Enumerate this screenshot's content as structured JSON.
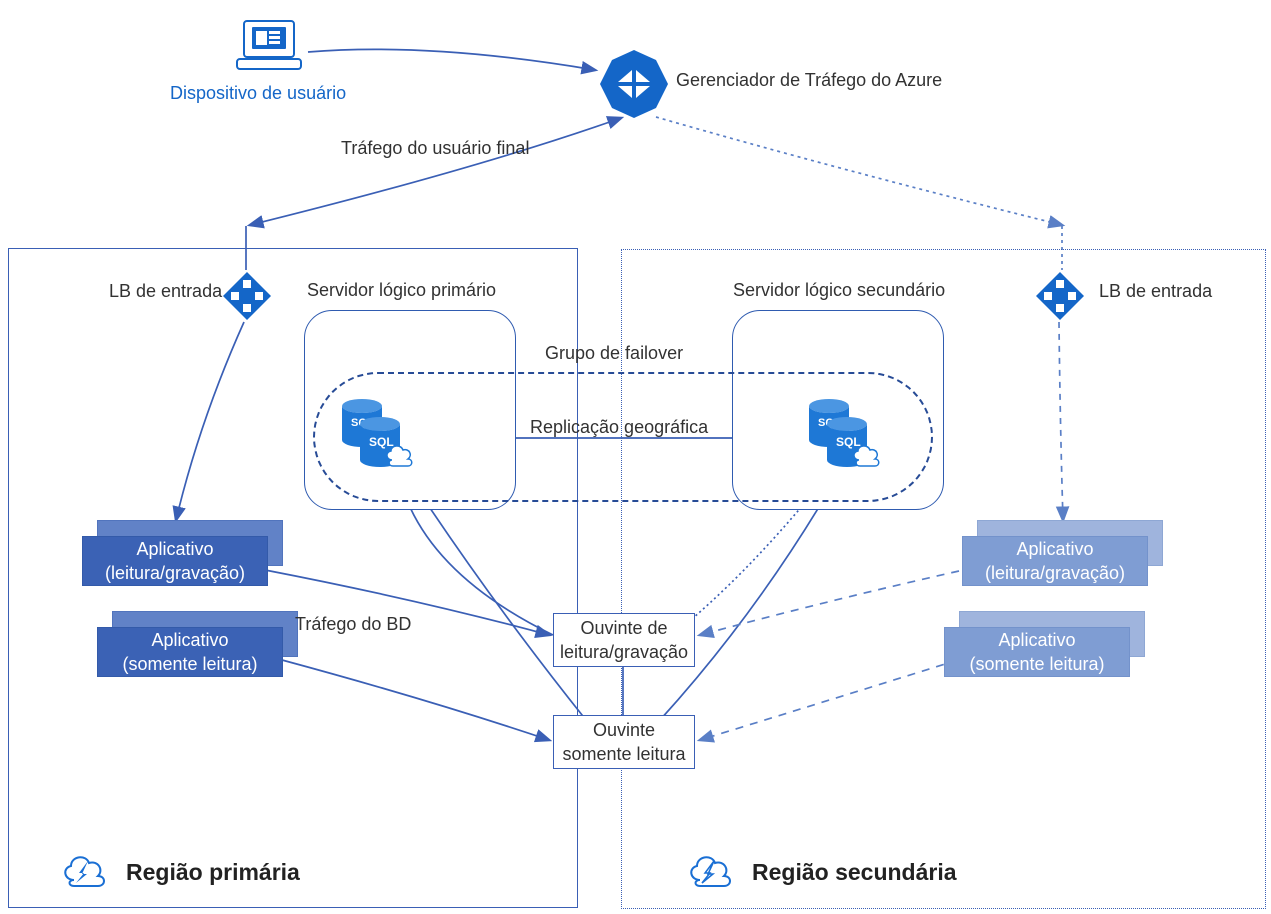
{
  "colors": {
    "azure_blue": "#1466c8",
    "line_solid": "#3a5fb5",
    "line_dashed": "#5a7fc6",
    "card_front": "#3b62b5",
    "card_back": "#6182c7",
    "card_front_muted": "#7f9dd3",
    "card_back_muted": "#9fb4dd",
    "text": "#323232"
  },
  "header": {
    "user_device_label": "Dispositivo de usuário",
    "traffic_manager_label": "Gerenciador de Tráfego do Azure",
    "end_user_traffic_label": "Tráfego do usuário final"
  },
  "primary_region": {
    "title": "Região primária",
    "lb_label": "LB de entrada",
    "server_label": "Servidor lógico primário",
    "app_rw": {
      "line1": "Aplicativo",
      "line2": "(leitura/gravação)"
    },
    "app_ro": {
      "line1": "Aplicativo",
      "line2": "(somente leitura)"
    },
    "db_traffic_label": "Tráfego do BD"
  },
  "failover_group": {
    "group_label": "Grupo de failover",
    "geo_replication_label": "Replicação geográfica",
    "listener_rw": {
      "line1": "Ouvinte de",
      "line2": "leitura/gravação"
    },
    "listener_ro": {
      "line1": "Ouvinte",
      "line2": "somente leitura"
    }
  },
  "secondary_region": {
    "title": "Região secundária",
    "lb_label": "LB de entrada",
    "server_label": "Servidor lógico secundário",
    "app_rw": {
      "line1": "Aplicativo",
      "line2": "(leitura/gravação)"
    },
    "app_ro": {
      "line1": "Aplicativo",
      "line2": "(somente leitura)"
    }
  },
  "icons": {
    "laptop": "laptop-icon",
    "tm": "traffic-manager-icon",
    "lb": "load-balancer-icon",
    "sqldb": "sql-database-icon",
    "cloud": "region-cloud-icon"
  }
}
